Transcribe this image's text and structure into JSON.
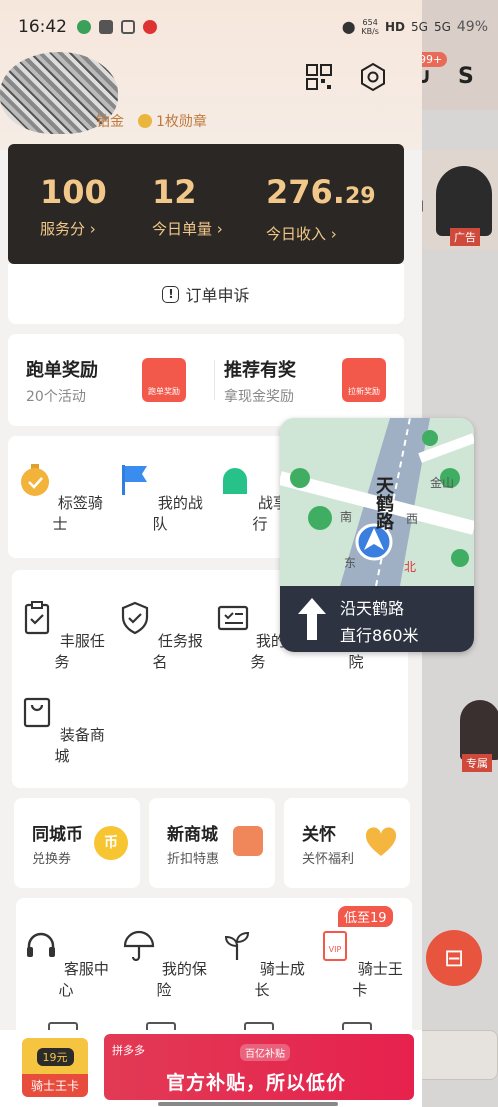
{
  "status_bar": {
    "time": "16:42",
    "net_speed": "654\nKB/s",
    "signal_labels": [
      "HD",
      "5G",
      "5G"
    ],
    "battery": "49%"
  },
  "profile": {
    "level_text": "铂金",
    "medal_text": "1枚勋章"
  },
  "stats": {
    "service_score": "100",
    "service_score_label": "服务分",
    "orders_today": "12",
    "orders_today_label": "今日单量",
    "income_today_int": "276.",
    "income_today_dec": "29",
    "income_today_label": "今日收入"
  },
  "appeal": {
    "label": "订单申诉"
  },
  "promo": {
    "left_title": "跑单奖励",
    "left_sub": "20个活动",
    "left_icon_text": "跑单奖励",
    "right_title": "推荐有奖",
    "right_sub": "拿现金奖励",
    "right_icon_text": "拉新奖励"
  },
  "row3": [
    "标签骑士",
    "我的战队",
    "战享晋行"
  ],
  "row4": [
    "丰服任务",
    "任务报名",
    "我的任务",
    "骑士学院",
    "装备商城"
  ],
  "minicards": [
    {
      "title": "同城币",
      "sub": "兑换券",
      "icon_text": "币"
    },
    {
      "title": "新商城",
      "sub": "折扣特惠"
    },
    {
      "title": "关怀",
      "sub": "关怀福利"
    }
  ],
  "row6": [
    "客服中心",
    "我的保险",
    "骑士成长",
    "骑士王卡"
  ],
  "vip_tag": "低至19",
  "vip_icon_text": "VIP",
  "bottom_ad": {
    "vip_price": "19元",
    "vip_name": "骑士王卡",
    "brand": "拼多多",
    "sub": "百亿补贴",
    "main": "官方补贴，所以低价"
  },
  "navigation": {
    "map_road_vertical": "天鹤路",
    "map_road_side": "金山",
    "map_road_marks": [
      "西",
      "南",
      "东",
      "北"
    ],
    "instruction_road": "沿天鹤路",
    "instruction_dist": "直行860米"
  },
  "background": {
    "badge": "99+",
    "ad_tag": "广告",
    "month_text": "月",
    "zs_tag": "专属"
  }
}
